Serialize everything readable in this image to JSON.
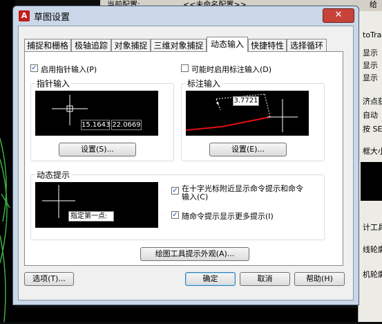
{
  "background": {
    "top_current_config_label": "当前配置:",
    "top_config_value": "<<未命名配置>>",
    "top_right_label": "给",
    "right_panel_items": [
      "toTrac",
      "显示",
      "显示",
      "显示",
      "济点获",
      "自动",
      "按 SE",
      "框大小",
      "计工具",
      "线轮廓",
      "机轮廓"
    ]
  },
  "dialog": {
    "title": "草图设置",
    "close_symbol": "✕",
    "tabs": [
      "捕捉和栅格",
      "极轴追踪",
      "对象捕捉",
      "三维对象捕捉",
      "动态输入",
      "快捷特性",
      "选择循环"
    ],
    "active_tab": "动态输入",
    "enable_pointer_input": {
      "checked": true,
      "label": "启用指针输入(P)"
    },
    "enable_dimension_input": {
      "checked": false,
      "label": "可能时启用标注输入(D)"
    },
    "pointer_input": {
      "group_title": "指针输入",
      "coord_x": "15.1643",
      "coord_y": "22.0669",
      "settings_button": "设置(S)..."
    },
    "dimension_input": {
      "group_title": "标注输入",
      "dim_value": "3.7721",
      "settings_button": "设置(E)..."
    },
    "dynamic_prompts": {
      "group_title": "动态提示",
      "prompt_text": "指定第一点:",
      "show_near_crosshair": {
        "checked": true,
        "label_line1": "在十字光标附近显示命令提示和命令",
        "label_line2": "输入(C)"
      },
      "show_more_prompts": {
        "checked": true,
        "label": "随命令提示显示更多提示(I)"
      }
    },
    "tooltip_appearance_button": "绘图工具提示外观(A)...",
    "buttons": {
      "options": "选项(T)...",
      "ok": "确定",
      "cancel": "取消",
      "help": "帮助(H)"
    }
  }
}
